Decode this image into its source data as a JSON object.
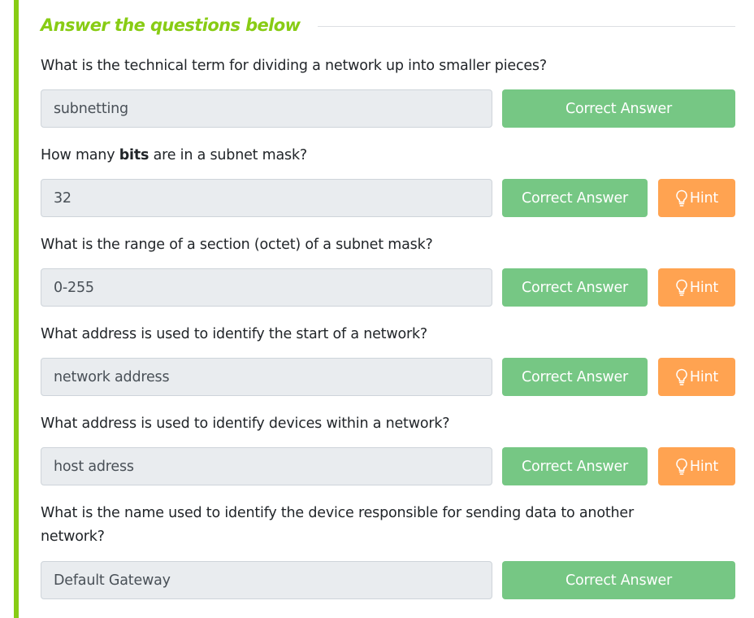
{
  "header": {
    "title": "Answer the questions below"
  },
  "questions": [
    {
      "text": "What is the technical term for dividing a network up into smaller pieces?",
      "answer": "subnetting",
      "correct_label": "Correct Answer"
    },
    {
      "text_before": "How many ",
      "text_bold": "bits",
      "text_after": " are in a subnet mask?",
      "answer": "32",
      "correct_label": "Correct Answer",
      "hint_label": "Hint"
    },
    {
      "text": "What is the range of a section (octet) of a subnet mask?",
      "answer": "0-255",
      "correct_label": "Correct Answer",
      "hint_label": "Hint"
    },
    {
      "text": "What address is used to identify the start of a network?",
      "answer": "network address",
      "correct_label": "Correct Answer",
      "hint_label": "Hint"
    },
    {
      "text": "What address is used to identify devices within a network?",
      "answer": "host adress",
      "correct_label": "Correct Answer",
      "hint_label": "Hint"
    },
    {
      "text": "What is the name used to identify the device responsible for sending data to another network?",
      "answer": "Default Gateway",
      "correct_label": "Correct Answer"
    }
  ],
  "colors": {
    "accent": "#88cc14",
    "correct": "#76c784",
    "hint": "#ffa351",
    "input_bg": "#e9ecef"
  },
  "icons": {
    "hint": "lightbulb-icon"
  }
}
